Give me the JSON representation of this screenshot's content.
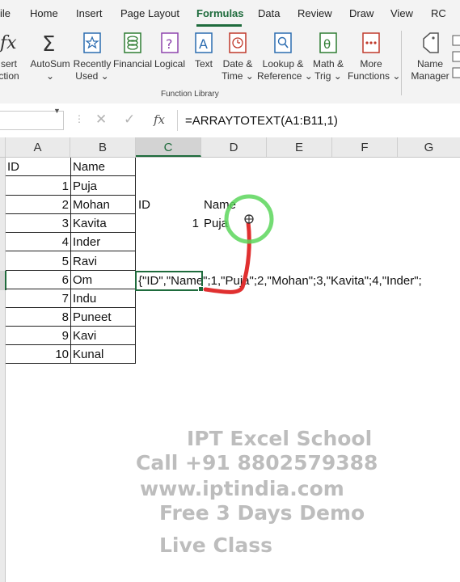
{
  "ribbon_tabs": [
    "ile",
    "Home",
    "Insert",
    "Page Layout",
    "Formulas",
    "Data",
    "Review",
    "Draw",
    "View",
    "RC"
  ],
  "ribbon": {
    "insert_function": [
      "sert",
      "ction"
    ],
    "autosum": "AutoSum",
    "recently_used": [
      "Recently",
      "Used"
    ],
    "financial": "Financial",
    "logical": "Logical",
    "text": "Text",
    "date_time": [
      "Date &",
      "Time"
    ],
    "lookup_reference": [
      "Lookup &",
      "Reference"
    ],
    "math_trig": [
      "Math &",
      "Trig"
    ],
    "more_functions": [
      "More",
      "Functions"
    ],
    "name_manager": [
      "Name",
      "Manager"
    ],
    "group_label": "Function Library"
  },
  "formula_bar": {
    "fx": "fx",
    "formula": "=ARRAYTOTEXT(A1:B11,1)"
  },
  "columns": [
    "A",
    "B",
    "C",
    "D",
    "E",
    "F",
    "G"
  ],
  "table": {
    "header": [
      "ID",
      "Name"
    ],
    "rows": [
      [
        "1",
        "Puja"
      ],
      [
        "2",
        "Mohan"
      ],
      [
        "3",
        "Kavita"
      ],
      [
        "4",
        "Inder"
      ],
      [
        "5",
        "Ravi"
      ],
      [
        "6",
        "Om"
      ],
      [
        "7",
        "Indu"
      ],
      [
        "8",
        "Puneet"
      ],
      [
        "9",
        "Kavi"
      ],
      [
        "10",
        "Kunal"
      ]
    ]
  },
  "spill": {
    "c3": "ID",
    "d3": "Name",
    "c4": "1",
    "d4": "Puja"
  },
  "active_cell_text": "{\"ID\",\"Name\";1,\"Puja\";2,\"Mohan\";3,\"Kavita\";4,\"Inder\";",
  "watermark": {
    "line1": "IPT Excel School",
    "line2": "Call +91 8802579388",
    "line3": "www.iptindia.com",
    "line4": "Free 3 Days Demo",
    "line5": "Live Class"
  },
  "colors": {
    "excel_green": "#1e6b3c",
    "annotation_red": "#e03030",
    "cursor_highlight": "#5cd65c"
  }
}
